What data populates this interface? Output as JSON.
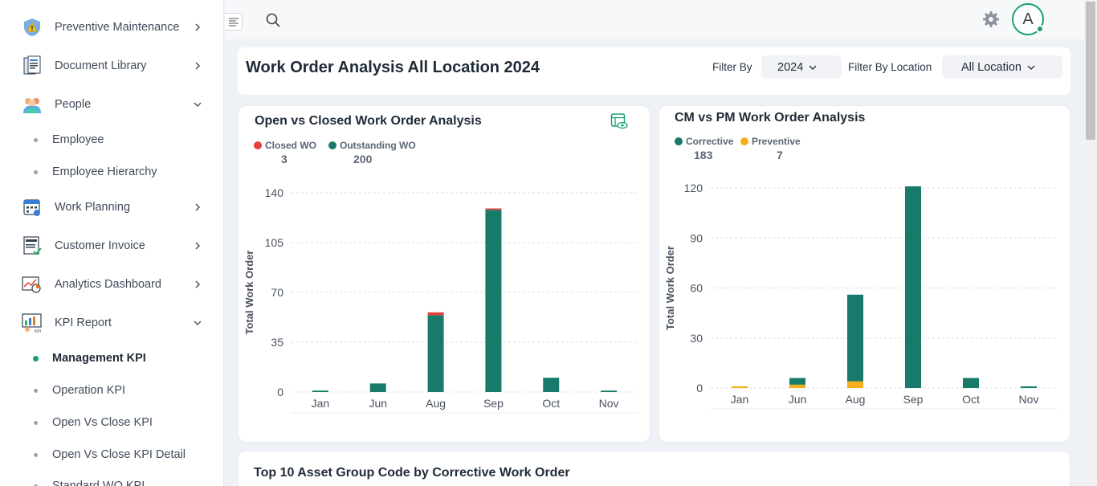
{
  "sidebar": {
    "items": [
      {
        "label": "Preventive Maintenance",
        "icon": "warning-shield-icon",
        "expanded": false
      },
      {
        "label": "Document Library",
        "icon": "document-icon",
        "expanded": false
      },
      {
        "label": "People",
        "icon": "people-icon",
        "expanded": true
      },
      {
        "label": "Work Planning",
        "icon": "calendar-icon",
        "expanded": false
      },
      {
        "label": "Customer Invoice",
        "icon": "invoice-icon",
        "expanded": false
      },
      {
        "label": "Analytics Dashboard",
        "icon": "analytics-icon",
        "expanded": false
      },
      {
        "label": "KPI Report",
        "icon": "kpi-icon",
        "expanded": true
      }
    ],
    "people_sub": [
      "Employee",
      "Employee Hierarchy"
    ],
    "kpi_sub": [
      "Management KPI",
      "Operation KPI",
      "Open Vs Close KPI",
      "Open Vs Close KPI Detail",
      "Standard WO KPI"
    ],
    "active_sub": "Management KPI"
  },
  "topbar": {
    "avatar_letter": "A"
  },
  "header": {
    "title": "Work Order Analysis All Location 2024",
    "filter_by_label": "Filter By",
    "filter_year": "2024",
    "filter_location_label": "Filter By Location",
    "filter_location": "All Location"
  },
  "colors": {
    "accent": "#1aa06d",
    "teal": "#177a6b",
    "red": "#e53e3e",
    "orange": "#f6ad1c"
  },
  "chart_data": [
    {
      "type": "bar",
      "title": "Open vs Closed Work Order Analysis",
      "ylabel": "Total Work Order",
      "ylim": [
        0,
        140
      ],
      "yticks": [
        0,
        35,
        70,
        105,
        140
      ],
      "categories": [
        "Jan",
        "Jun",
        "Aug",
        "Sep",
        "Oct",
        "Nov"
      ],
      "stacked": true,
      "series": [
        {
          "name": "Closed WO",
          "color": "#e53e3e",
          "values": [
            0,
            0,
            2,
            1,
            0,
            0
          ]
        },
        {
          "name": "Outstanding WO",
          "color": "#177a6b",
          "values": [
            1,
            6,
            54,
            128,
            10,
            1
          ]
        }
      ],
      "totals": {
        "Closed WO": "3",
        "Outstanding WO": "200"
      },
      "grid": true
    },
    {
      "type": "bar",
      "title": "CM vs PM Work Order Analysis",
      "ylabel": "Total Work Order",
      "ylim": [
        0,
        120
      ],
      "yticks": [
        0,
        30,
        60,
        90,
        120
      ],
      "categories": [
        "Jan",
        "Jun",
        "Aug",
        "Sep",
        "Oct",
        "Nov"
      ],
      "stacked": true,
      "series": [
        {
          "name": "Corrective",
          "color": "#177a6b",
          "values": [
            0,
            4,
            52,
            121,
            6,
            1
          ]
        },
        {
          "name": "Preventive",
          "color": "#f6ad1c",
          "values": [
            1,
            2,
            4,
            0,
            0,
            0
          ]
        }
      ],
      "totals": {
        "Corrective": "183",
        "Preventive": "7"
      },
      "grid": true
    }
  ],
  "bottom": {
    "title": "Top 10 Asset Group Code by Corrective Work Order"
  }
}
